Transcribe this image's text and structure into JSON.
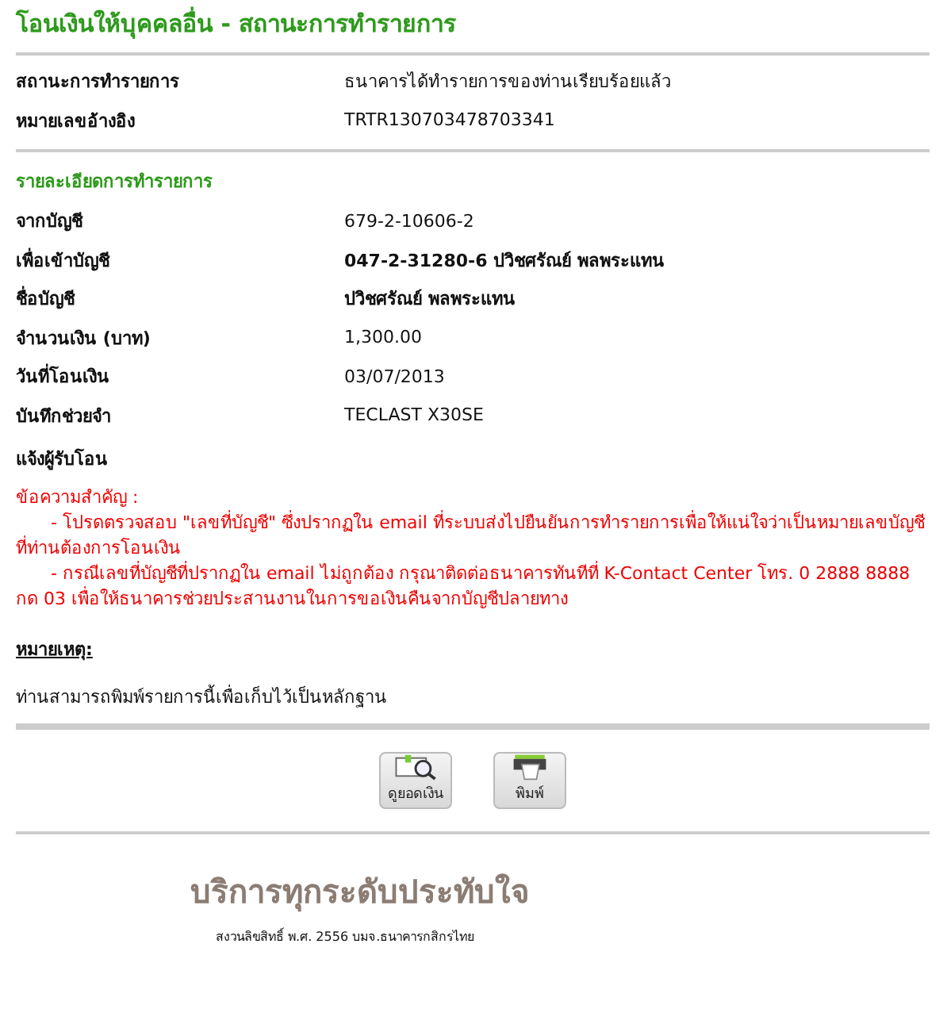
{
  "title": "โอนเงินให้บุคคลอื่น - สถานะการทำรายการ",
  "status_rows": [
    {
      "label": "สถานะการทำรายการ",
      "value": "ธนาคารได้ทำรายการของท่านเรียบร้อยแล้ว",
      "bold": false
    },
    {
      "label": "หมายเลขอ้างอิง",
      "value": "TRTR130703478703341",
      "bold": false
    }
  ],
  "details": {
    "heading": "รายละเอียดการทำรายการ",
    "rows": [
      {
        "label": "จากบัญชี",
        "value": "679-2-10606-2",
        "bold": false
      },
      {
        "label": "เพื่อเข้าบัญชี",
        "value": "047-2-31280-6 ปวิชศรัณย์ พลพระแทน",
        "bold": true
      },
      {
        "label": "ชื่อบัญชี",
        "value": "ปวิชศรัณย์ พลพระแทน",
        "bold": true
      },
      {
        "label": "จำนวนเงิน (บาท)",
        "value": "1,300.00",
        "bold": false
      },
      {
        "label": "วันที่โอนเงิน",
        "value": "03/07/2013",
        "bold": false
      },
      {
        "label": "บันทึกช่วยจำ",
        "value": "TECLAST X30SE",
        "bold": false
      }
    ],
    "notify_label": "แจ้งผู้รับโอน"
  },
  "important": {
    "heading": "ข้อความสำคัญ :",
    "items": [
      "- โปรดตรวจสอบ \"เลขที่บัญชี\" ซึ่งปรากฏใน email ที่ระบบส่งไปยืนยันการทำรายการเพื่อให้แน่ใจว่าเป็นหมายเลขบัญชีที่ท่านต้องการโอนเงิน",
      "- กรณีเลขที่บัญชีที่ปรากฏใน email ไม่ถูกต้อง กรุณาติดต่อธนาคารทันทีที่ K-Contact Center โทร. 0 2888 8888 กด 03 เพื่อให้ธนาคารช่วยประสานงานในการขอเงินคืนจากบัญชีปลายทาง"
    ]
  },
  "remark": {
    "heading": "หมายเหตุ:",
    "text": "ท่านสามารถพิมพ์รายการนี้เพื่อเก็บไว้เป็นหลักฐาน"
  },
  "buttons": [
    {
      "kind": "balance",
      "label": "ดูยอดเงิน"
    },
    {
      "kind": "print",
      "label": "พิมพ์"
    }
  ],
  "footer": {
    "slogan": "บริการทุกระดับประทับใจ",
    "copyright": "สงวนลิขสิทธิ์ พ.ศ. 2556 บมจ.ธนาคารกสิกรไทย"
  }
}
